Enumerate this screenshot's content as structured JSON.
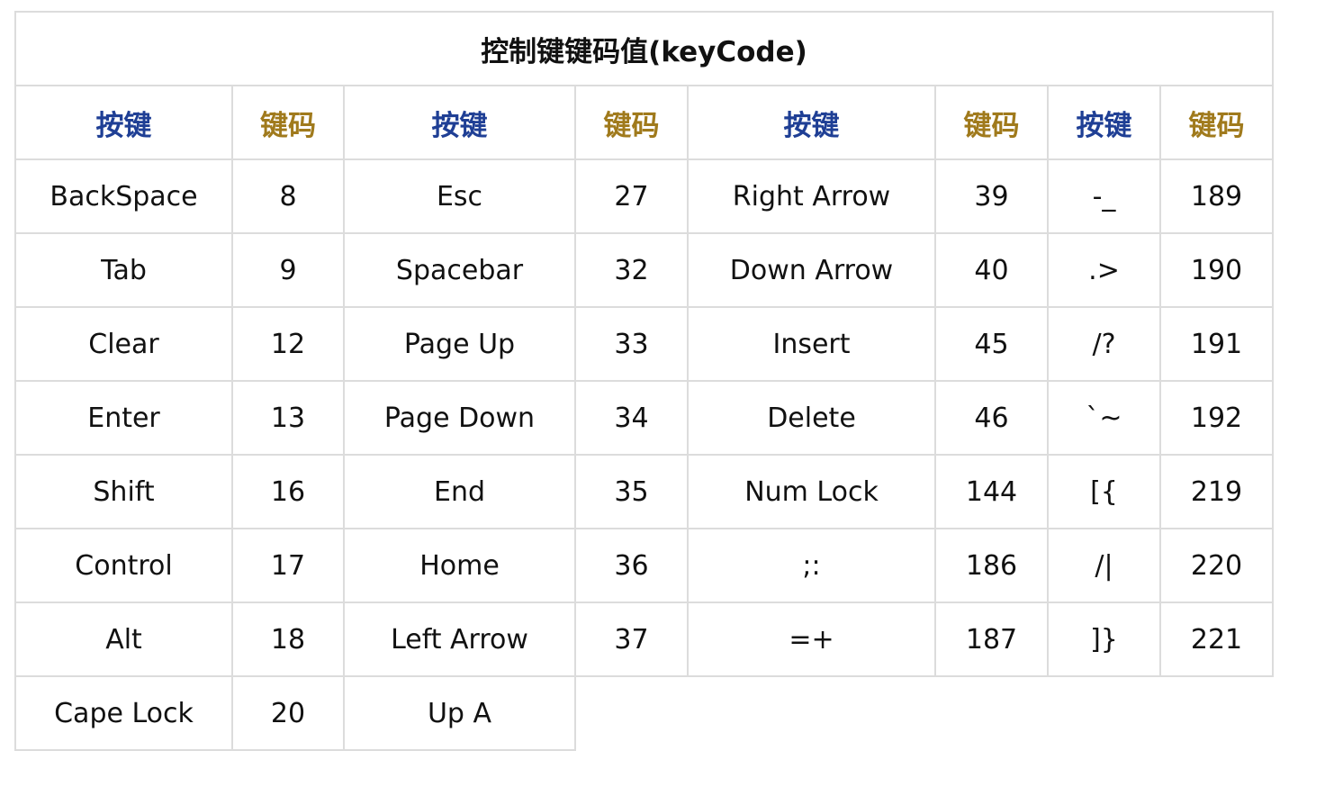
{
  "title": "控制键键码值(keyCode)",
  "headers": [
    "按键",
    "键码",
    "按键",
    "键码",
    "按键",
    "键码",
    "按键",
    "键码"
  ],
  "colors": {
    "key_header": "#1f3f95",
    "code_header": "#a07a1c",
    "border": "#dcdcdc"
  },
  "rows": [
    [
      "BackSpace",
      "8",
      "Esc",
      "27",
      "Right Arrow",
      "39",
      "-_",
      "189"
    ],
    [
      "Tab",
      "9",
      "Spacebar",
      "32",
      "Down Arrow",
      "40",
      ".>",
      "190"
    ],
    [
      "Clear",
      "12",
      "Page Up",
      "33",
      "Insert",
      "45",
      "/?",
      "191"
    ],
    [
      "Enter",
      "13",
      "Page Down",
      "34",
      "Delete",
      "46",
      "`~",
      "192"
    ],
    [
      "Shift",
      "16",
      "End",
      "35",
      "Num Lock",
      "144",
      "[{",
      "219"
    ],
    [
      "Control",
      "17",
      "Home",
      "36",
      ";:",
      "186",
      "/|",
      "220"
    ],
    [
      "Alt",
      "18",
      "Left Arrow",
      "37",
      "=+",
      "187",
      "]}",
      "221"
    ],
    [
      "Cape Lock",
      "20",
      "Up A",
      "",
      "",
      "",
      "",
      ""
    ]
  ]
}
